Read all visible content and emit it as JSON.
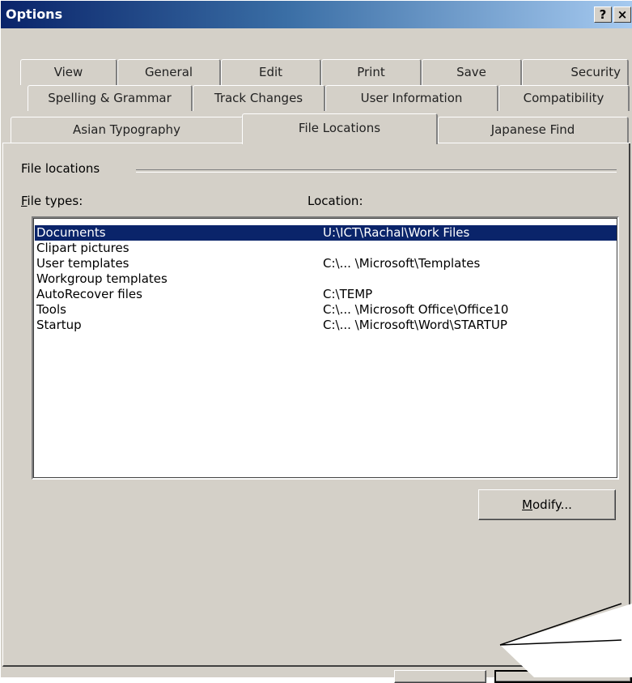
{
  "window": {
    "title": "Options",
    "help_label": "?",
    "close_label": "×"
  },
  "tabs": {
    "row1": [
      "View",
      "General",
      "Edit",
      "Print",
      "Save",
      "Security"
    ],
    "row2": [
      "Spelling & Grammar",
      "Track Changes",
      "User Information",
      "Compatibility"
    ],
    "row3": [
      "Asian Typography",
      "File Locations",
      "Japanese Find"
    ],
    "active": "File Locations"
  },
  "group": {
    "label": "File locations"
  },
  "list": {
    "col_types_prefix": "F",
    "col_types_rest": "ile types:",
    "col_location": "Location:",
    "rows": [
      {
        "type": "Documents",
        "location": "U:\\ICT\\Rachal\\Work Files",
        "selected": true
      },
      {
        "type": "Clipart pictures",
        "location": ""
      },
      {
        "type": "User templates",
        "location": "C:\\... \\Microsoft\\Templates"
      },
      {
        "type": "Workgroup templates",
        "location": ""
      },
      {
        "type": "AutoRecover files",
        "location": "C:\\TEMP"
      },
      {
        "type": "Tools",
        "location": "C:\\... \\Microsoft Office\\Office10"
      },
      {
        "type": "Startup",
        "location": "C:\\... \\Microsoft\\Word\\STARTUP"
      }
    ]
  },
  "buttons": {
    "modify_prefix": "M",
    "modify_rest": "odify..."
  },
  "colors": {
    "face": "#d4d0c8",
    "title_start": "#0a246a",
    "title_end": "#a6caf0",
    "selection": "#0a246a"
  }
}
